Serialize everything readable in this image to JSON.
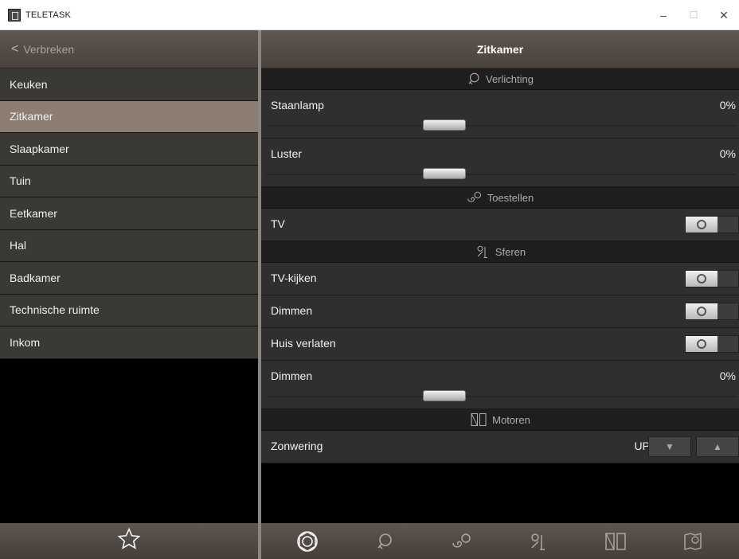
{
  "window": {
    "title": "TELETASK",
    "minimize": "–",
    "maximize": "☐",
    "close": "✕"
  },
  "left": {
    "back_label": "Verbreken",
    "rooms": [
      {
        "label": "Keuken",
        "active": false
      },
      {
        "label": "Zitkamer",
        "active": true
      },
      {
        "label": "Slaapkamer",
        "active": false
      },
      {
        "label": "Tuin",
        "active": false
      },
      {
        "label": "Eetkamer",
        "active": false
      },
      {
        "label": "Hal",
        "active": false
      },
      {
        "label": "Badkamer",
        "active": false
      },
      {
        "label": "Technische ruimte",
        "active": false
      },
      {
        "label": "Inkom",
        "active": false
      }
    ],
    "footer_icon": "star-icon"
  },
  "right": {
    "title": "Zitkamer",
    "sections": {
      "verlichting": "Verlichting",
      "toestellen": "Toestellen",
      "sferen": "Sferen",
      "motoren": "Motoren"
    },
    "rows": {
      "staanlamp": {
        "label": "Staanlamp",
        "value": "0%",
        "level": 0
      },
      "luster": {
        "label": "Luster",
        "value": "0%",
        "level": 0
      },
      "tv": {
        "label": "TV",
        "state": "off"
      },
      "tv_kijken": {
        "label": "TV-kijken",
        "state": "off"
      },
      "dimmen_toggle": {
        "label": "Dimmen",
        "state": "off"
      },
      "huis_verlaten": {
        "label": "Huis verlaten",
        "state": "off"
      },
      "dimmen_slider": {
        "label": "Dimmen",
        "value": "0%",
        "level": 0
      },
      "zonwering": {
        "label": "Zonwering",
        "state": "UP",
        "down": "▼",
        "up": "▲"
      }
    },
    "footer_icons": [
      "flower-icon",
      "bulb-icon",
      "plug-icon",
      "scene-icon",
      "door-icon",
      "map-icon"
    ]
  },
  "colors": {
    "active_room": "#8b7d71",
    "header": "#5e5650",
    "row": "#2f2f2f"
  }
}
